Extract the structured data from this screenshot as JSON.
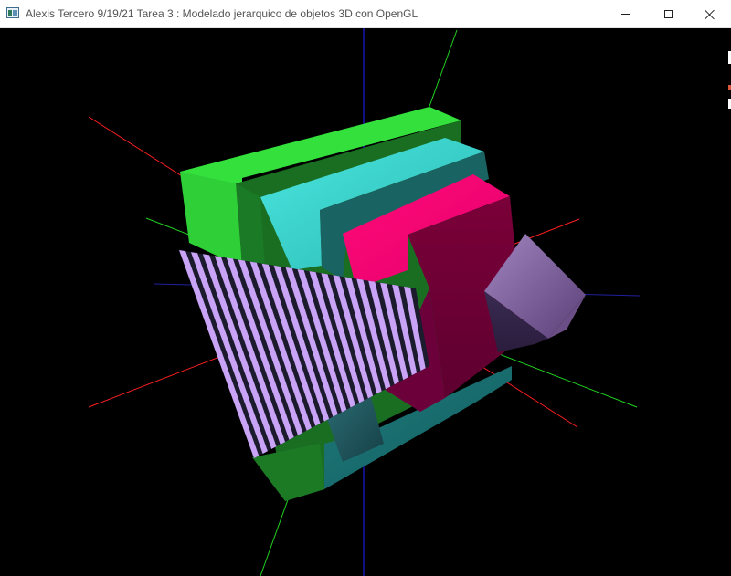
{
  "window": {
    "title": "Alexis Tercero 9/19/21 Tarea 3 : Modelado jerarquico de objetos 3D con OpenGL",
    "icon": "opengl-app-icon",
    "controls": [
      "minimize-icon",
      "maximize-icon",
      "close-icon"
    ]
  },
  "scene": {
    "background": "#000000",
    "axis_colors": {
      "x": "#ff2020",
      "y": "#20d020",
      "z": "#2020ff"
    },
    "object_colors": {
      "green_box": "#33e03c",
      "cyan_box": "#3ed9d2",
      "magenta_box": "#ff0a78",
      "striped_panel": "#c9a3f5",
      "purple_cube": "#6b4e86"
    }
  }
}
